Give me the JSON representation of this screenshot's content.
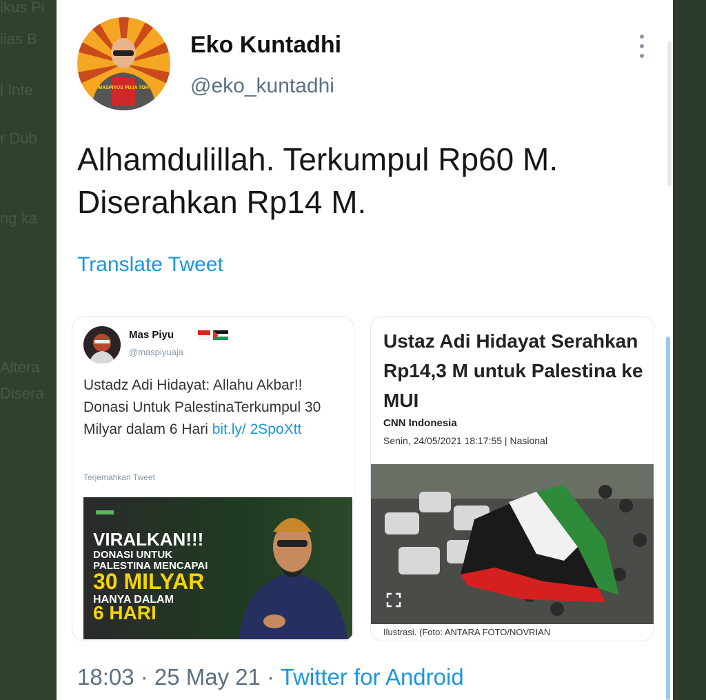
{
  "background": {
    "left_fragments": [
      "ikus Pi",
      "ilas B",
      "l Inte",
      "r Dub",
      "ng ka",
      "Altera",
      "Disera"
    ]
  },
  "tweet": {
    "author_name": "Eko Kuntadhi",
    "author_handle": "@eko_kuntadhi",
    "text_line1": "Alhamdulillah. Terkumpul Rp60 M.",
    "text_line2": "Diserahkan Rp14 M.",
    "translate_label": "Translate Tweet",
    "timestamp": "18:03 · 25 May 21 · ",
    "client": "Twitter for Android",
    "more_icon": "more-vertical-icon",
    "avatar_caption": "MASPIYUS PUJA TOH"
  },
  "embed_left": {
    "author_name": "Mas Piyu",
    "author_handle": "@maspiyuaja",
    "text": "Ustadz Adi Hidayat: Allahu Akbar!! Donasi Untuk PalestinaTerkumpul 30 Milyar dalam 6 Hari ",
    "link": "bit.ly/ 2SpoXtt",
    "translate_label": "Terjemahkan Tweet",
    "promo": {
      "line1": "VIRALKAN!!!",
      "line2": "DONASI UNTUK",
      "line3": "PALESTINA MENCAPAI",
      "line4": "30 MILYAR",
      "line5": "HANYA DALAM",
      "line6": "6 HARI"
    }
  },
  "embed_right": {
    "headline": "Ustaz Adi Hidayat Serahkan Rp14,3 M untuk Palestina ke MUI",
    "source": "CNN Indonesia",
    "dateline": "Senin, 24/05/2021 18:17:55 | Nasional",
    "caption": "Ilustrasi. (Foto: ANTARA FOTO/NOVRIAN"
  },
  "colors": {
    "link": "#1b95e0",
    "secondary_text": "#5b7083",
    "primary_text": "#14171a"
  }
}
